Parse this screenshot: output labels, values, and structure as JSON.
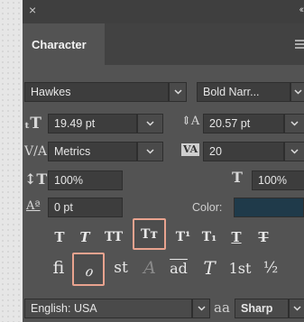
{
  "panel": {
    "close_glyph": "×",
    "collapse_glyph": "‹‹",
    "tab_label": "Character"
  },
  "font": {
    "family": "Hawkes",
    "style": "Bold Narr..."
  },
  "size": {
    "font_size": "19.49 pt",
    "leading": "20.57 pt"
  },
  "spacing": {
    "kerning": "Metrics",
    "tracking": "20"
  },
  "scale": {
    "vertical": "100%",
    "horizontal": "100%"
  },
  "baseline": {
    "shift": "0 pt",
    "color_label": "Color:",
    "color_swatch": "#1f3a4a"
  },
  "type_styles": [
    {
      "glyph": "T",
      "name": "faux-bold"
    },
    {
      "glyph": "T",
      "name": "faux-italic"
    },
    {
      "glyph": "TT",
      "name": "all-caps"
    },
    {
      "glyph": "Tт",
      "name": "small-caps"
    },
    {
      "glyph": "T¹",
      "name": "superscript"
    },
    {
      "glyph": "T₁",
      "name": "subscript"
    },
    {
      "glyph": "T",
      "name": "underline"
    },
    {
      "glyph": "T",
      "name": "strikethrough"
    }
  ],
  "opentype": [
    {
      "glyph": "fi",
      "name": "standard-ligatures"
    },
    {
      "glyph": "ℴ",
      "name": "contextual-alternates"
    },
    {
      "glyph": "st",
      "name": "discretionary-ligatures"
    },
    {
      "glyph": "A",
      "name": "swash"
    },
    {
      "glyph": "ad",
      "name": "stylistic-alternates"
    },
    {
      "glyph": "T",
      "name": "titling-alternates"
    },
    {
      "glyph": "1st",
      "name": "ordinals"
    },
    {
      "glyph": "½",
      "name": "fractions"
    }
  ],
  "footer": {
    "language": "English: USA",
    "aa_label": "aa",
    "antialias": "Sharp"
  },
  "colors": {
    "highlight": "#e9a38f",
    "panel": "#535353"
  }
}
